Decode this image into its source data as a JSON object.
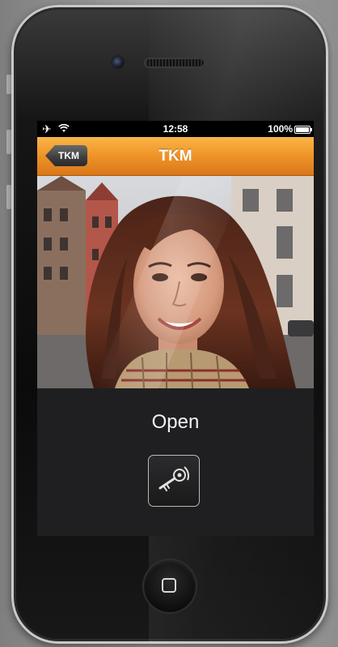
{
  "statusbar": {
    "time": "12:58",
    "battery_text": "100%",
    "icons": [
      "airplane-icon",
      "wifi-icon",
      "battery-icon"
    ]
  },
  "navbar": {
    "back_label": "TKM",
    "title": "TKM",
    "color": "#f0962a"
  },
  "video": {
    "icon": "video-feed-image"
  },
  "action": {
    "open_label": "Open",
    "icon": "key-icon"
  },
  "colors": {
    "screen_background": "#1f1f21",
    "accent": "#f0962a"
  }
}
